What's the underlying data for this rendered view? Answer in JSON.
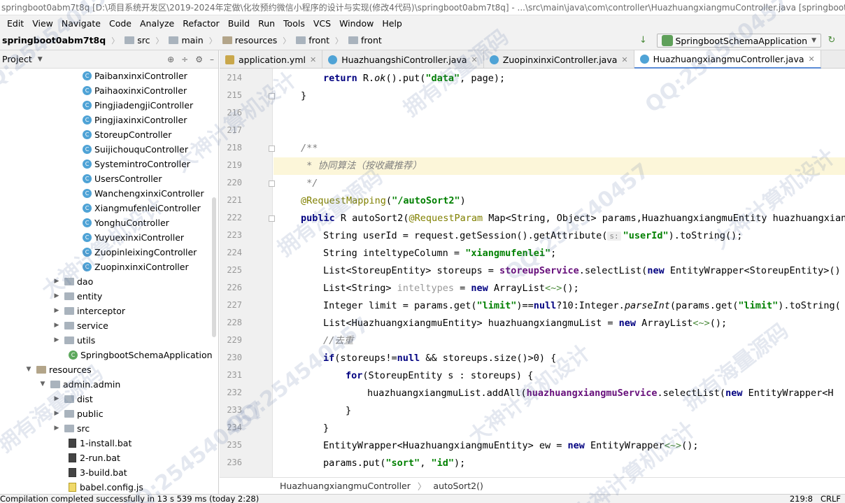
{
  "window": {
    "title": "springboot0abm7t8q [D:\\项目系统开发区\\2019-2024年定做\\化妆预约微信小程序的设计与实现(修改4代码)\\springboot0abm7t8q] - ...\\src\\main\\java\\com\\controller\\HuazhuangxiangmuController.java [springboot..."
  },
  "menu": [
    "Edit",
    "View",
    "Navigate",
    "Code",
    "Analyze",
    "Refactor",
    "Build",
    "Run",
    "Tools",
    "VCS",
    "Window",
    "Help"
  ],
  "nav": {
    "project": "springboot0abm7t8q",
    "crumbs": [
      "src",
      "main",
      "resources",
      "front",
      "front"
    ],
    "run_config": "SpringbootSchemaApplication"
  },
  "project_pane": {
    "title": "Project",
    "tree": [
      {
        "label": "PaibanxinxiController",
        "kind": "class"
      },
      {
        "label": "PaihaoxinxiController",
        "kind": "class"
      },
      {
        "label": "PingjiadengjiController",
        "kind": "class"
      },
      {
        "label": "PingjiaxinxiController",
        "kind": "class"
      },
      {
        "label": "StoreupController",
        "kind": "class"
      },
      {
        "label": "SuijichouquController",
        "kind": "class"
      },
      {
        "label": "SystemintroController",
        "kind": "class"
      },
      {
        "label": "UsersController",
        "kind": "class"
      },
      {
        "label": "WanchengxinxiController",
        "kind": "class"
      },
      {
        "label": "XiangmufenleiController",
        "kind": "class"
      },
      {
        "label": "YonghuController",
        "kind": "class"
      },
      {
        "label": "YuyuexinxiController",
        "kind": "class"
      },
      {
        "label": "ZuopinleixingController",
        "kind": "class"
      },
      {
        "label": "ZuopinxinxiController",
        "kind": "class"
      },
      {
        "label": "dao",
        "kind": "folder"
      },
      {
        "label": "entity",
        "kind": "folder"
      },
      {
        "label": "interceptor",
        "kind": "folder"
      },
      {
        "label": "service",
        "kind": "folder"
      },
      {
        "label": "utils",
        "kind": "folder"
      },
      {
        "label": "SpringbootSchemaApplication",
        "kind": "spring"
      },
      {
        "label": "resources",
        "kind": "resfolder"
      },
      {
        "label": "admin.admin",
        "kind": "folder"
      },
      {
        "label": "dist",
        "kind": "folder"
      },
      {
        "label": "public",
        "kind": "folder"
      },
      {
        "label": "src",
        "kind": "folder"
      },
      {
        "label": "1-install.bat",
        "kind": "bat"
      },
      {
        "label": "2-run.bat",
        "kind": "bat"
      },
      {
        "label": "3-build.bat",
        "kind": "bat"
      },
      {
        "label": "babel.config.js",
        "kind": "js"
      }
    ]
  },
  "tabs": [
    {
      "label": "application.yml",
      "kind": "yml"
    },
    {
      "label": "HuazhuangshiController.java",
      "kind": "java"
    },
    {
      "label": "ZuopinxinxiController.java",
      "kind": "java"
    },
    {
      "label": "HuazhuangxiangmuController.java",
      "kind": "java",
      "active": true
    }
  ],
  "line_numbers": [
    "214",
    "215",
    "216",
    "217",
    "218",
    "219",
    "220",
    "221",
    "222",
    "223",
    "224",
    "225",
    "226",
    "227",
    "228",
    "229",
    "230",
    "231",
    "232",
    "233",
    "234",
    "235",
    "236"
  ],
  "code": {
    "l214": {
      "a": "return",
      "b": " R.",
      "c": "ok",
      "d": "().put(",
      "e": "\"data\"",
      "f": ", page);"
    },
    "l215": "}",
    "l218": "/**",
    "l219": " * 协同算法（按收藏推荐）",
    "l220": " */",
    "l221": {
      "a": "@RequestMapping",
      "b": "(",
      "c": "\"/autoSort2\"",
      "d": ")"
    },
    "l222": {
      "a": "public",
      "b": " R autoSort2(",
      "c": "@RequestParam",
      "d": " Map<String, Object> params,HuazhuangxiangmuEntity huazhuangxiangmu"
    },
    "l223": {
      "a": "String userId = request.getSession().getAttribute(",
      "hint": "s:",
      "b": "\"userId\"",
      "c": ").toString();"
    },
    "l224": {
      "a": "String inteltypeColumn = ",
      "b": "\"xiangmufenlei\"",
      "c": ";"
    },
    "l225": {
      "a": "List<StoreupEntity> storeups = ",
      "b": "storeupService",
      "c": ".selectList(",
      "d": "new",
      "e": " EntityWrapper<StoreupEntity>()"
    },
    "l226": {
      "a": "List<String> ",
      "b": "inteltypes",
      "c": " = ",
      "d": "new",
      "e": " ArrayList",
      "f": "<~>",
      "g": "();"
    },
    "l227": {
      "a": "Integer limit = params.get(",
      "b": "\"limit\"",
      "c": ")==",
      "d": "null",
      "e": "?10:Integer.",
      "f": "parseInt",
      "g": "(params.get(",
      "h": "\"limit\"",
      "i": ").toString("
    },
    "l228": {
      "a": "List<HuazhuangxiangmuEntity> huazhuangxiangmuList = ",
      "b": "new",
      "c": " ArrayList",
      "d": "<~>",
      "e": "();"
    },
    "l229": "//去重",
    "l230": {
      "a": "if",
      "b": "(storeups!=",
      "c": "null",
      "d": " && storeups.size()>0) {"
    },
    "l231": {
      "a": "for",
      "b": "(StoreupEntity s : storeups) {"
    },
    "l232": {
      "a": "huazhuangxiangmuList.addAll(",
      "b": "huazhuangxiangmuService",
      "c": ".selectList(",
      "d": "new",
      "e": " EntityWrapper<H"
    },
    "l233": "}",
    "l234": "}",
    "l235": {
      "a": "EntityWrapper<HuazhuangxiangmuEntity> ew = ",
      "b": "new",
      "c": " EntityWrapper",
      "d": "<~>",
      "e": "();"
    },
    "l236": {
      "a": "params.put(",
      "b": "\"sort\"",
      "c": ", ",
      "d": "\"id\"",
      "e": ");"
    }
  },
  "editor_breadcrumb": [
    "HuazhuangxiangmuController",
    "autoSort2()"
  ],
  "status": {
    "message": "Compilation completed successfully in 13 s 539 ms (today 2:28)",
    "position": "219:8",
    "line_sep": "CRLF"
  },
  "watermarks": [
    "QQ:254540457",
    "大神计算机设计",
    "拥有海量源码"
  ]
}
